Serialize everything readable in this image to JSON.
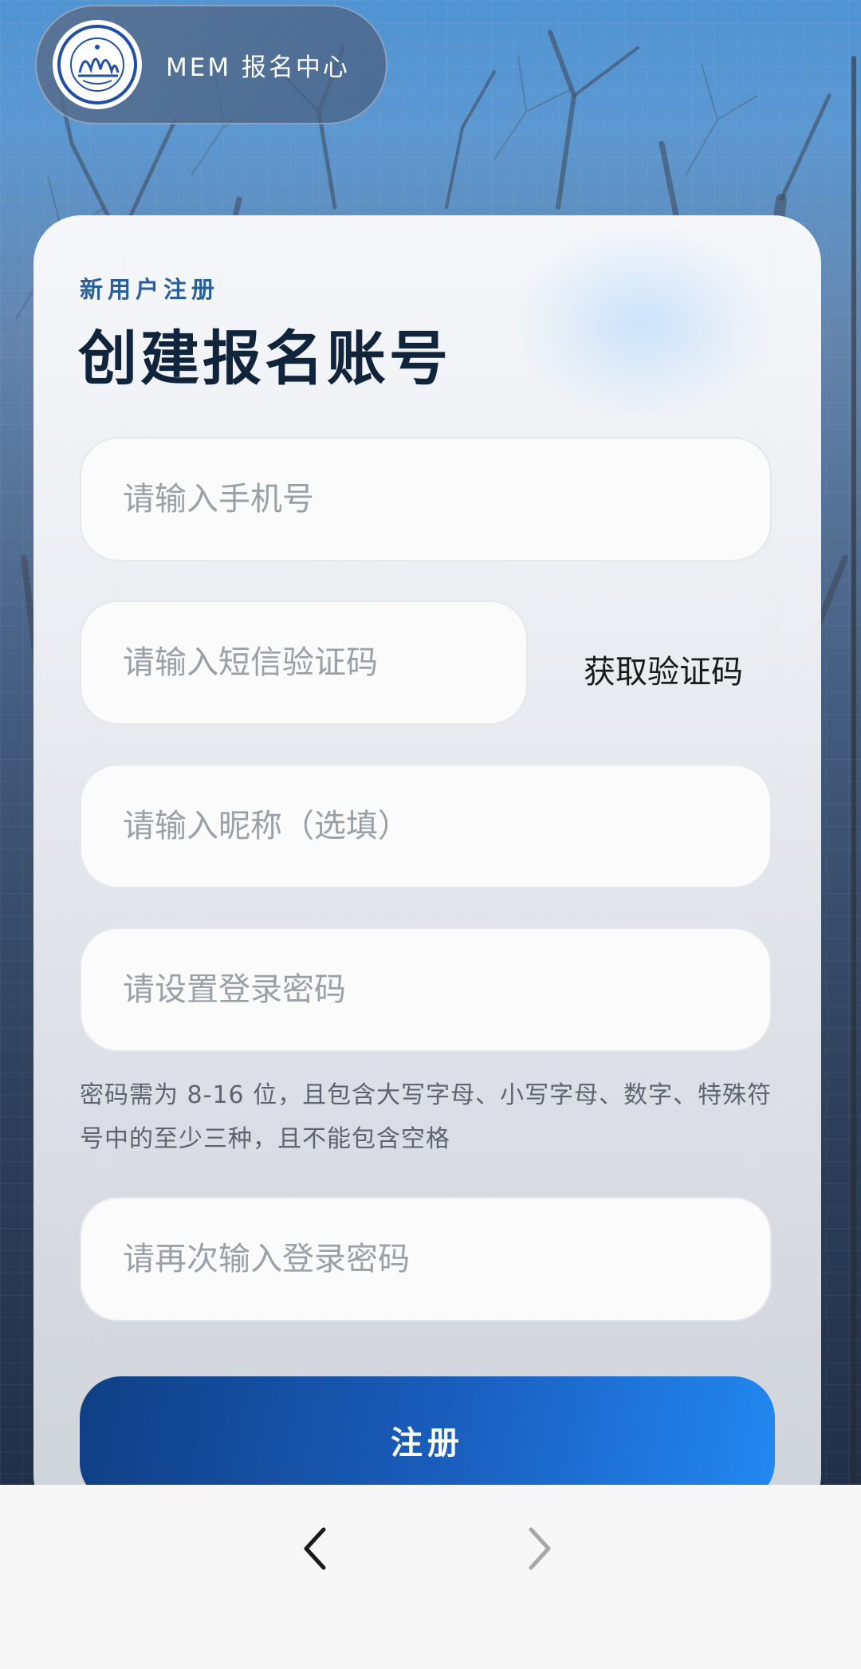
{
  "header": {
    "logo_icon": "tongji-university-emblem",
    "title": "MEM 报名中心"
  },
  "form": {
    "subtitle": "新用户注册",
    "title": "创建报名账号",
    "phone": {
      "placeholder": "请输入手机号",
      "value": ""
    },
    "sms_code": {
      "placeholder": "请输入短信验证码",
      "value": ""
    },
    "get_code_label": "获取验证码",
    "nickname": {
      "placeholder": "请输入昵称（选填）",
      "value": ""
    },
    "password": {
      "placeholder": "请设置登录密码",
      "value": ""
    },
    "password_hint": "密码需为 8-16 位，且包含大写字母、小写字母、数字、特殊符号中的至少三种，且不能包含空格",
    "confirm_password": {
      "placeholder": "请再次输入登录密码",
      "value": ""
    },
    "submit_label": "注册"
  },
  "toolbar": {
    "back_icon": "chevron-left-icon",
    "forward_icon": "chevron-right-icon",
    "forward_enabled": false
  },
  "colors": {
    "accent": "#1a5fc0",
    "title": "#10243c",
    "subtitle": "#2b5f9a"
  }
}
